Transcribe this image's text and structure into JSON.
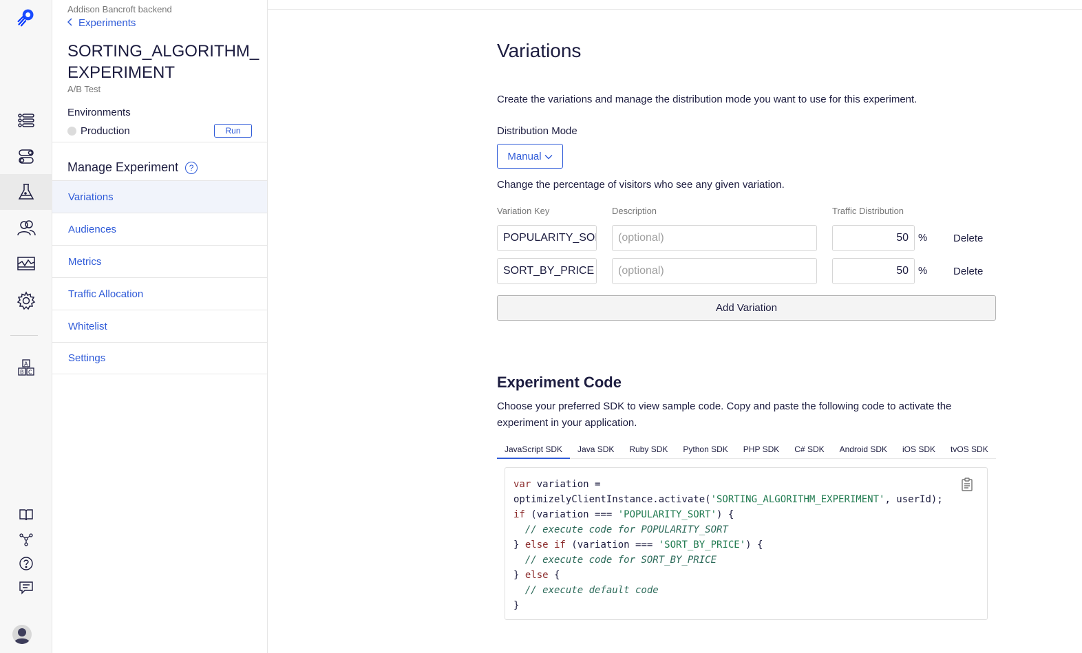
{
  "sidebar": {
    "project_name": "Addison Bancroft backend",
    "back_label": "Experiments",
    "experiment_title": "SORTING_ALGORITHM_EXPERIMENT",
    "experiment_type": "A/B Test",
    "environments_label": "Environments",
    "environment_name": "Production",
    "run_label": "Run",
    "manage_title": "Manage Experiment",
    "help_symbol": "?",
    "nav": [
      {
        "label": "Variations"
      },
      {
        "label": "Audiences"
      },
      {
        "label": "Metrics"
      },
      {
        "label": "Traffic Allocation"
      },
      {
        "label": "Whitelist"
      },
      {
        "label": "Settings"
      }
    ]
  },
  "variations": {
    "title": "Variations",
    "description": "Create the variations and manage the distribution mode you want to use for this experiment.",
    "distribution_label": "Distribution Mode",
    "distribution_value": "Manual",
    "change_text": "Change the percentage of visitors who see any given variation.",
    "headers": {
      "key": "Variation Key",
      "description": "Description",
      "traffic": "Traffic Distribution"
    },
    "rows": [
      {
        "key": "POPULARITY_SORT",
        "description_placeholder": "(optional)",
        "traffic": "50",
        "percent": "%",
        "delete": "Delete"
      },
      {
        "key": "SORT_BY_PRICE",
        "description_placeholder": "(optional)",
        "traffic": "50",
        "percent": "%",
        "delete": "Delete"
      }
    ],
    "add_label": "Add Variation"
  },
  "code": {
    "title": "Experiment Code",
    "description": "Choose your preferred SDK to view sample code. Copy and paste the following code to activate the experiment in your application.",
    "tabs": [
      {
        "label": "JavaScript SDK"
      },
      {
        "label": "Java SDK"
      },
      {
        "label": "Ruby SDK"
      },
      {
        "label": "Python SDK"
      },
      {
        "label": "PHP SDK"
      },
      {
        "label": "C# SDK"
      },
      {
        "label": "Android SDK"
      },
      {
        "label": "iOS SDK"
      },
      {
        "label": "tvOS SDK"
      }
    ],
    "snippet": {
      "l1_kw": "var",
      "l1_rest": " variation =",
      "l2_a": "optimizelyClientInstance.activate(",
      "l2_str": "'SORTING_ALGORITHM_EXPERIMENT'",
      "l2_b": ", userId);",
      "l3_kw": "if",
      "l3_a": " (variation === ",
      "l3_str": "'POPULARITY_SORT'",
      "l3_b": ") {",
      "l4_cmt": "  // execute code for POPULARITY_SORT",
      "l5_a": "} ",
      "l5_kw": "else if",
      "l5_b": " (variation === ",
      "l5_str": "'SORT_BY_PRICE'",
      "l5_c": ") {",
      "l6_cmt": "  // execute code for SORT_BY_PRICE",
      "l7_a": "} ",
      "l7_kw": "else",
      "l7_b": " {",
      "l8_cmt": "  // execute default code",
      "l9": "}"
    }
  },
  "colors": {
    "accent": "#2f5bd8",
    "text": "#1d1d40",
    "muted": "#767676"
  }
}
